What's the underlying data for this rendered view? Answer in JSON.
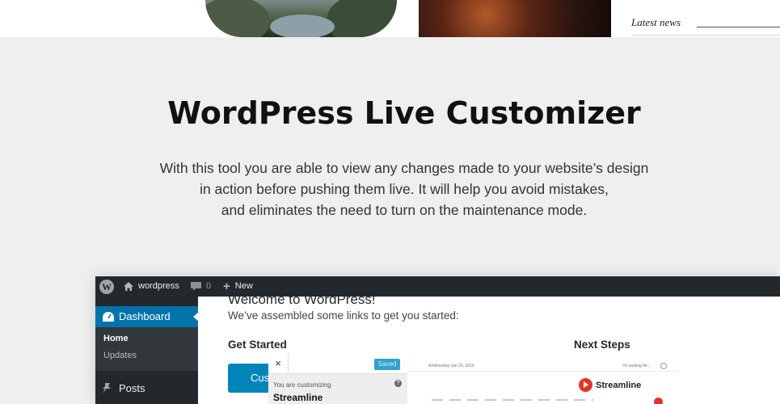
{
  "top": {
    "latest_news": "Latest news"
  },
  "hero": {
    "title": "WordPress Live Customizer",
    "description_lines": [
      "With this tool you are able to view any changes made to your website’s design",
      "in action before pushing them live. It will help you avoid mistakes,",
      "and eliminates the need to turn on the maintenance mode."
    ]
  },
  "screenshot": {
    "adminbar": {
      "site_name": "wordpress",
      "comments_count": "0",
      "new_label": "New"
    },
    "sidebar": {
      "dashboard": "Dashboard",
      "home": "Home",
      "updates": "Updates",
      "posts": "Posts"
    },
    "content": {
      "welcome": "Welcome to WordPress!",
      "assembled": "We’ve assembled some links to get you started:",
      "get_started": "Get Started",
      "next_steps": "Next Steps",
      "button_partial": "Cus"
    },
    "customizer": {
      "close": "×",
      "saved": "Saved",
      "you_are_customizing": "You are customizing",
      "help": "?",
      "site_title": "Streamline"
    },
    "preview": {
      "date": "Wednesday Jan 29, 2016",
      "search_placeholder": "I'm looking for...",
      "logo_text": "Streamline"
    }
  },
  "colors": {
    "admin_bar": "#23282d",
    "accent_blue": "#0073aa",
    "logo_red": "#e4322b",
    "background": "#efefef"
  }
}
